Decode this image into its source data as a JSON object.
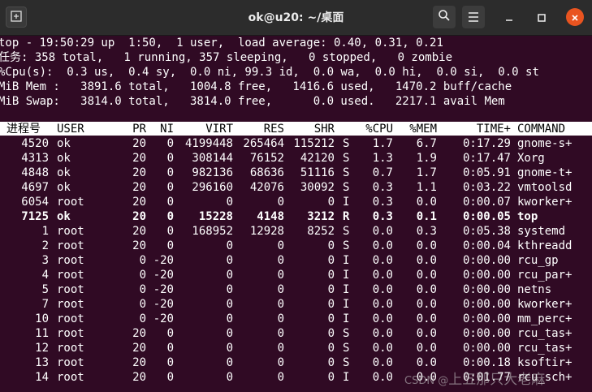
{
  "window": {
    "title": "ok@u20: ~/桌面",
    "icons": {
      "new_tab": "new-tab-icon",
      "search": "search-icon",
      "menu": "hamburger-menu-icon",
      "minimize": "minimize-icon",
      "maximize": "maximize-icon",
      "close": "close-icon"
    }
  },
  "summary": [
    "top - 19:50:29 up  1:50,  1 user,  load average: 0.40, 0.31, 0.21",
    "任务: 358 total,   1 running, 357 sleeping,   0 stopped,   0 zombie",
    "%Cpu(s):  0.3 us,  0.4 sy,  0.0 ni, 99.3 id,  0.0 wa,  0.0 hi,  0.0 si,  0.0 st",
    "MiB Mem :   3891.6 total,   1004.8 free,   1416.6 used,   1470.2 buff/cache",
    "MiB Swap:   3814.0 total,   3814.0 free,      0.0 used.   2217.1 avail Mem"
  ],
  "columns": [
    "进程号",
    "USER",
    "PR",
    "NI",
    "VIRT",
    "RES",
    "SHR",
    "",
    "%CPU",
    "%MEM",
    "TIME+",
    "COMMAND"
  ],
  "processes": [
    [
      "4520",
      "ok",
      "20",
      "0",
      "4199448",
      "265464",
      "115212",
      "S",
      "1.7",
      "6.7",
      "0:17.29",
      "gnome-s+"
    ],
    [
      "4313",
      "ok",
      "20",
      "0",
      "308144",
      "76152",
      "42120",
      "S",
      "1.3",
      "1.9",
      "0:17.47",
      "Xorg"
    ],
    [
      "4848",
      "ok",
      "20",
      "0",
      "982136",
      "68636",
      "51116",
      "S",
      "0.7",
      "1.7",
      "0:05.91",
      "gnome-t+"
    ],
    [
      "4697",
      "ok",
      "20",
      "0",
      "296160",
      "42076",
      "30092",
      "S",
      "0.3",
      "1.1",
      "0:03.22",
      "vmtoolsd"
    ],
    [
      "6054",
      "root",
      "20",
      "0",
      "0",
      "0",
      "0",
      "I",
      "0.3",
      "0.0",
      "0:00.07",
      "kworker+"
    ],
    [
      "7125",
      "ok",
      "20",
      "0",
      "15228",
      "4148",
      "3212",
      "R",
      "0.3",
      "0.1",
      "0:00.05",
      "top"
    ],
    [
      "1",
      "root",
      "20",
      "0",
      "168952",
      "12928",
      "8252",
      "S",
      "0.0",
      "0.3",
      "0:05.38",
      "systemd"
    ],
    [
      "2",
      "root",
      "20",
      "0",
      "0",
      "0",
      "0",
      "S",
      "0.0",
      "0.0",
      "0:00.04",
      "kthreadd"
    ],
    [
      "3",
      "root",
      "0",
      "-20",
      "0",
      "0",
      "0",
      "I",
      "0.0",
      "0.0",
      "0:00.00",
      "rcu_gp"
    ],
    [
      "4",
      "root",
      "0",
      "-20",
      "0",
      "0",
      "0",
      "I",
      "0.0",
      "0.0",
      "0:00.00",
      "rcu_par+"
    ],
    [
      "5",
      "root",
      "0",
      "-20",
      "0",
      "0",
      "0",
      "I",
      "0.0",
      "0.0",
      "0:00.00",
      "netns"
    ],
    [
      "7",
      "root",
      "0",
      "-20",
      "0",
      "0",
      "0",
      "I",
      "0.0",
      "0.0",
      "0:00.00",
      "kworker+"
    ],
    [
      "10",
      "root",
      "0",
      "-20",
      "0",
      "0",
      "0",
      "I",
      "0.0",
      "0.0",
      "0:00.00",
      "mm_perc+"
    ],
    [
      "11",
      "root",
      "20",
      "0",
      "0",
      "0",
      "0",
      "S",
      "0.0",
      "0.0",
      "0:00.00",
      "rcu_tas+"
    ],
    [
      "12",
      "root",
      "20",
      "0",
      "0",
      "0",
      "0",
      "S",
      "0.0",
      "0.0",
      "0:00.00",
      "rcu_tas+"
    ],
    [
      "13",
      "root",
      "20",
      "0",
      "0",
      "0",
      "0",
      "S",
      "0.0",
      "0.0",
      "0:00.18",
      "ksoftir+"
    ],
    [
      "14",
      "root",
      "20",
      "0",
      "0",
      "0",
      "0",
      "I",
      "0.0",
      "0.0",
      "0:01.77",
      "rcu_sch+"
    ]
  ],
  "highlighted_pid": "7125",
  "watermark": {
    "prefix": "CSDN @",
    "author": "上五那只大老麻"
  },
  "colors": {
    "terminal_bg": "#300a24",
    "titlebar_bg": "#2c2c2c",
    "text": "#ffffff",
    "close_button": "#e95420"
  }
}
